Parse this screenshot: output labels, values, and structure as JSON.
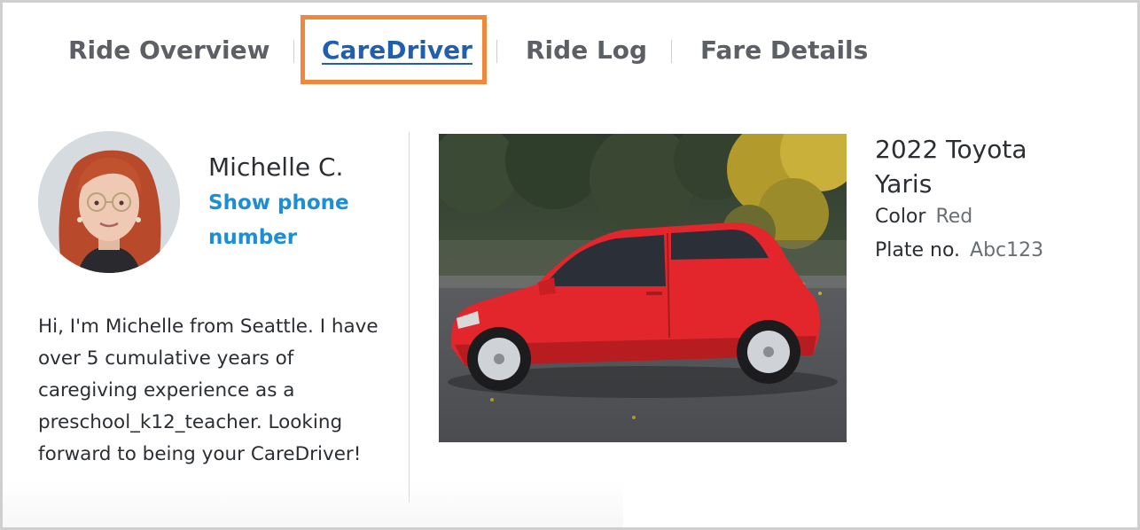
{
  "tabs": [
    {
      "label": "Ride Overview"
    },
    {
      "label": "CareDriver"
    },
    {
      "label": "Ride Log"
    },
    {
      "label": "Fare Details"
    }
  ],
  "active_tab": "CareDriver",
  "driver": {
    "name": "Michelle C.",
    "phone_link": "Show phone number",
    "bio": "Hi, I'm Michelle from Seattle. I have over 5 cumulative years of caregiving experience as a preschool_k12_teacher. Looking forward to being your CareDriver!"
  },
  "vehicle": {
    "title": "2022 Toyota Yaris",
    "color_label": "Color",
    "color_value": "Red",
    "plate_label": "Plate no.",
    "plate_value": "Abc123"
  },
  "colors": {
    "accent_link": "#1a8fd6",
    "active_tab": "#1f5fae",
    "highlight": "#f0873a",
    "car_body": "#e3262b"
  }
}
